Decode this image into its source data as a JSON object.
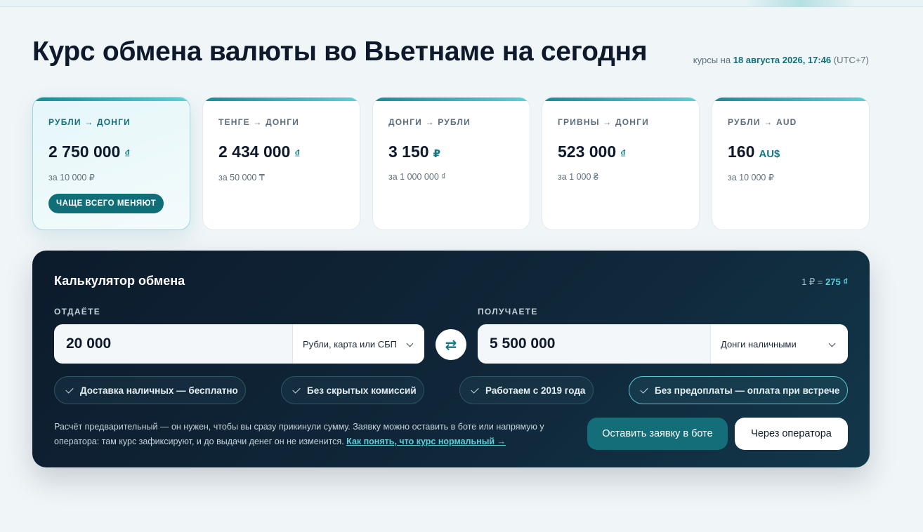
{
  "header": {
    "title": "Курс обмена валюты во Вьетнаме на сегодня",
    "rates_prefix": "курсы на",
    "rates_date": "18 августа 2026, 17:46",
    "rates_tz": "(UTC+7)"
  },
  "cards": [
    {
      "pair": "РУБЛИ → ДОНГИ",
      "amount": "2 750 000",
      "currency": "₫",
      "for": "за 10 000 ₽",
      "badge": "ЧАЩЕ ВСЕГО МЕНЯЮТ",
      "active": true
    },
    {
      "pair": "ТЕНГЕ → ДОНГИ",
      "amount": "2 434 000",
      "currency": "₫",
      "for": "за 50 000 ₸"
    },
    {
      "pair": "ДОНГИ → РУБЛИ",
      "amount": "3 150",
      "currency": "₽",
      "for": "за 1 000 000 ₫"
    },
    {
      "pair": "ГРИВНЫ → ДОНГИ",
      "amount": "523 000",
      "currency": "₫",
      "for": "за 1 000 ₴"
    },
    {
      "pair": "РУБЛИ → AUD",
      "amount": "160",
      "currency": "AU$",
      "for": "за 10 000 ₽"
    }
  ],
  "calculator": {
    "title": "Калькулятор обмена",
    "rate_prefix": "1 ₽ =",
    "rate_value": "275 ₫",
    "give_label": "ОТДАЁТЕ",
    "give_value": "20 000",
    "give_method": "Рубли, карта или СБП",
    "get_label": "ПОЛУЧАЕТЕ",
    "get_value": "5 500 000",
    "get_method": "Донги наличными",
    "swap_icon": "⇄",
    "features": [
      "Доставка наличных — бесплатно",
      "Без скрытых комиссий",
      "Работаем с 2019 года",
      "Без предоплаты — оплата при встрече"
    ],
    "note": "Расчёт предварительный — он нужен, чтобы вы сразу прикинули сумму. Заявку можно оставить в боте или напрямую у оператора: там курс зафиксируют, и до выдачи денег он не изменится.",
    "note_link": "Как понять, что курс нормальный →",
    "bot_button": "Оставить заявку в боте",
    "operator_button": "Через оператора"
  },
  "colors": {
    "accent": "#146e7a",
    "accent_light": "#5bd0dc",
    "panel_dark": "#0c1b2c",
    "page_bg": "#f0f5f8"
  }
}
